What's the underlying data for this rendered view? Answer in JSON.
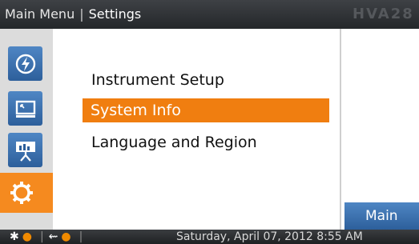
{
  "header": {
    "breadcrumb_root": "Main Menu",
    "breadcrumb_separator": "|",
    "breadcrumb_current": "Settings",
    "model_label": "HVA28"
  },
  "sidebar": {
    "items": [
      {
        "icon": "power-icon",
        "active": false
      },
      {
        "icon": "monitor-icon",
        "active": false
      },
      {
        "icon": "presentation-icon",
        "active": false
      },
      {
        "icon": "gear-icon",
        "active": true
      }
    ]
  },
  "menu": {
    "items": [
      {
        "label": "Instrument Setup",
        "selected": false
      },
      {
        "label": "System Info",
        "selected": true
      },
      {
        "label": "Language and Region",
        "selected": false
      }
    ]
  },
  "buttons": {
    "main_label": "Main"
  },
  "status": {
    "datetime": "Saturday, April 07, 2012 8:55 AM",
    "icons": [
      "bluetooth-icon",
      "usb-icon"
    ]
  },
  "colors": {
    "accent": "#f07e10",
    "sidebar_blue": "#3b72b3",
    "topbar": "#2e3134"
  }
}
